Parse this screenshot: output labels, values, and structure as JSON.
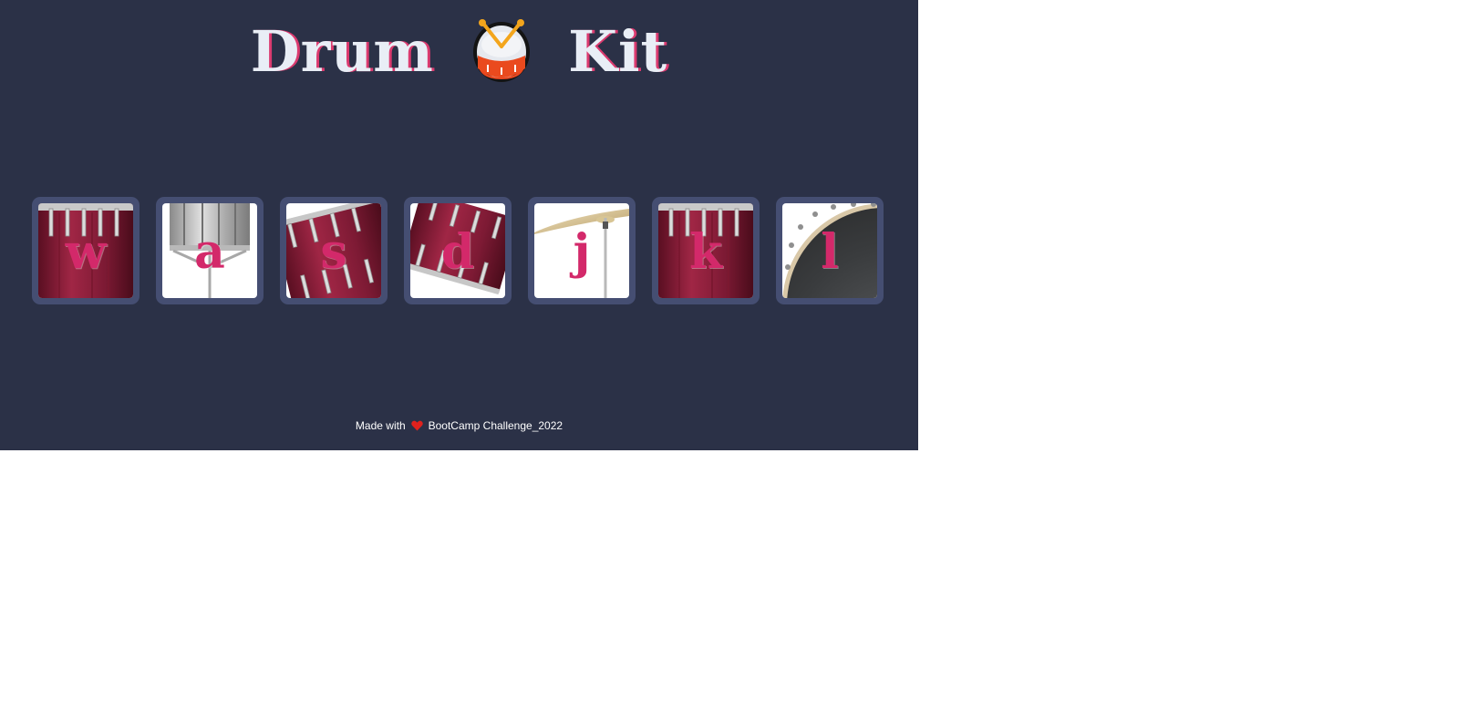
{
  "header": {
    "title_left": "Drum",
    "title_right": "Kit",
    "icon": "drum-icon"
  },
  "pads": [
    {
      "key": "w",
      "image": "tom-drum"
    },
    {
      "key": "a",
      "image": "snare-drum-on-stand"
    },
    {
      "key": "s",
      "image": "tilted-tom-drum"
    },
    {
      "key": "d",
      "image": "tilted-tom-drum"
    },
    {
      "key": "j",
      "image": "crash-cymbal"
    },
    {
      "key": "k",
      "image": "tom-drum"
    },
    {
      "key": "l",
      "image": "bass-drum"
    }
  ],
  "footer": {
    "prefix": "Made with",
    "icon": "heart-icon",
    "suffix": "BootCamp Challenge_2022"
  },
  "colors": {
    "background": "#2b3147",
    "pad_frame": "#454e72",
    "key_letter": "#d3296a",
    "title_shadow": "#db3a6f",
    "drum_red": "#8e1f3c"
  }
}
